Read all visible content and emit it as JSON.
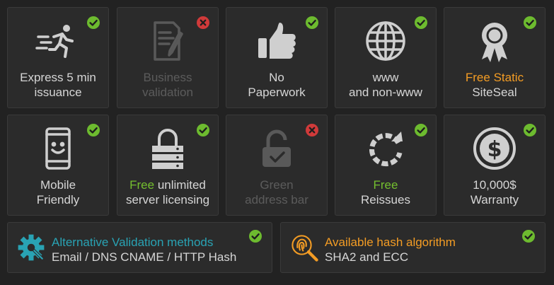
{
  "tiles": [
    {
      "line1": "Express 5 min",
      "line2": "issuance",
      "icon": "running-man-icon",
      "status": "check"
    },
    {
      "line1": "Business",
      "line2": "validation",
      "icon": "document-pen-icon",
      "status": "cross"
    },
    {
      "line1": "No",
      "line2": "Paperwork",
      "icon": "thumbs-up-icon",
      "status": "check"
    },
    {
      "line1": "www",
      "line2": "and non-www",
      "icon": "globe-icon",
      "status": "check"
    },
    {
      "line1_highlight": "Free Static",
      "line2": "SiteSeal",
      "icon": "award-ribbon-icon",
      "status": "check"
    },
    {
      "line1": "Mobile",
      "line2": "Friendly",
      "icon": "smartphone-icon",
      "status": "check"
    },
    {
      "line1_highlight": "Free",
      "line1_rest": " unlimited",
      "line2": "server licensing",
      "icon": "lock-server-icon",
      "status": "check"
    },
    {
      "line1": "Green",
      "line2": "address bar",
      "icon": "padlock-icon",
      "status": "cross"
    },
    {
      "line1_highlight": "Free",
      "line2": "Reissues",
      "icon": "refresh-icon",
      "status": "check"
    },
    {
      "line1": "10,000$",
      "line2": "Warranty",
      "icon": "dollar-coin-icon",
      "status": "check"
    }
  ],
  "wide": [
    {
      "title": "Alternative Validation methods",
      "detail": "Email / DNS CNAME / HTTP Hash",
      "icon": "gear-wrench-icon",
      "status": "check"
    },
    {
      "title": "Available hash algorithm",
      "detail": "SHA2 and ECC",
      "icon": "fingerprint-search-icon",
      "status": "check"
    }
  ],
  "colors": {
    "accent_orange": "#f39c24",
    "accent_green": "#74bf2f",
    "accent_teal": "#29a3b4",
    "check": "#6dbb2f",
    "cross": "#d03a3a"
  }
}
